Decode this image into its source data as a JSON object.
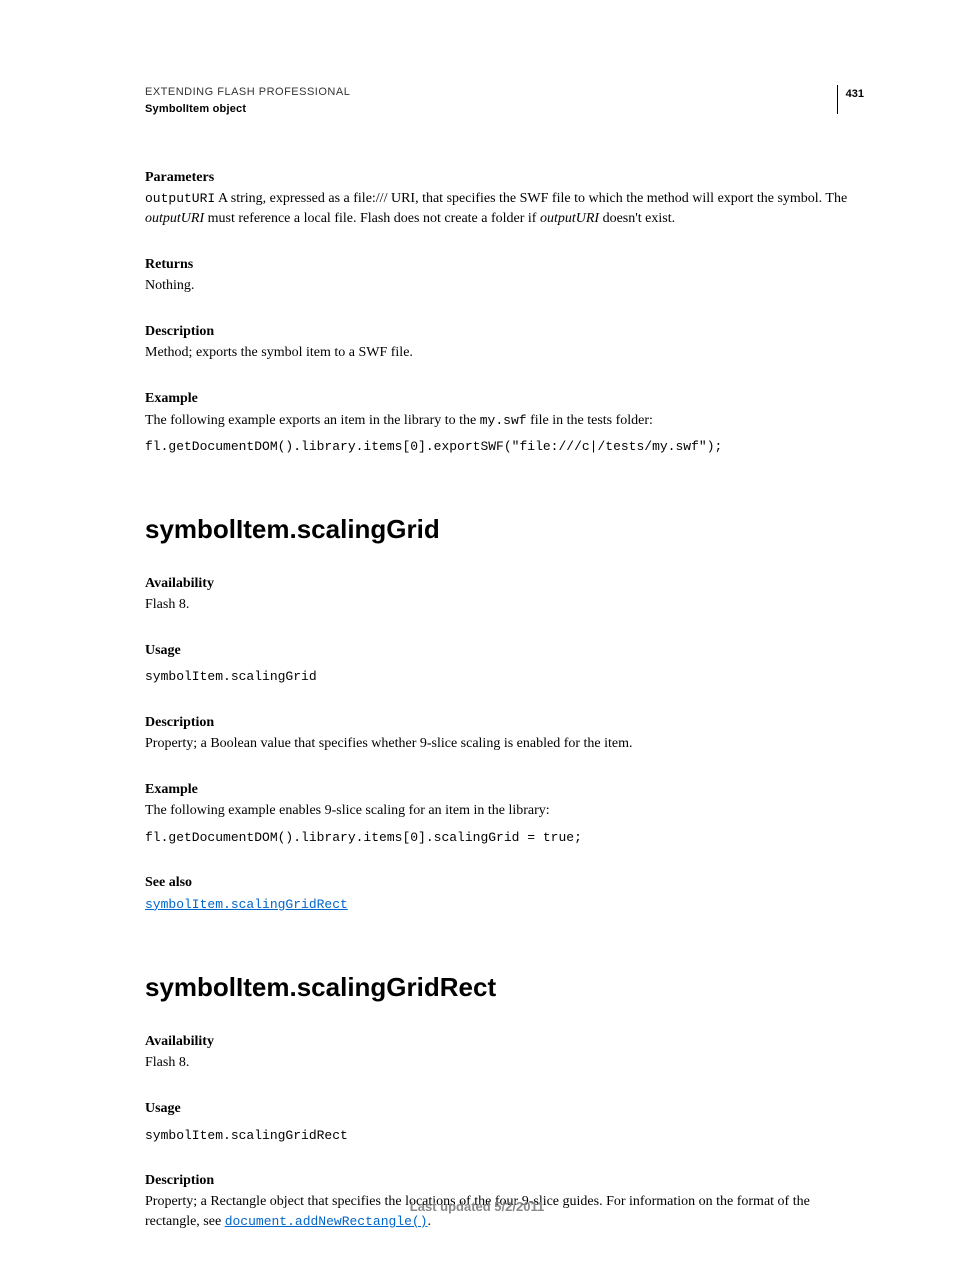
{
  "header": {
    "title": "EXTENDING FLASH PROFESSIONAL",
    "subtitle": "SymbolItem object",
    "pageNumber": "431"
  },
  "s1": {
    "parametersLabel": "Parameters",
    "paramName": "outputURI",
    "paramText1": "  A string, expressed as a file:/// URI, that specifies the SWF file to which the method will export the symbol. The ",
    "paramItalic1": "outputURI",
    "paramText2": " must reference a local file. Flash does not create a folder if ",
    "paramItalic2": "outputURI",
    "paramText3": " doesn't exist.",
    "returnsLabel": "Returns",
    "returnsText": "Nothing.",
    "descriptionLabel": "Description",
    "descriptionText": "Method; exports the symbol item to a SWF file.",
    "exampleLabel": "Example",
    "exampleText1": "The following example exports an item in the library to the ",
    "exampleCode1": "my.swf",
    "exampleText2": " file in the tests folder:",
    "codeBlock": "fl.getDocumentDOM().library.items[0].exportSWF(\"file:///c|/tests/my.swf\");"
  },
  "s2": {
    "heading": "symbolItem.scalingGrid",
    "availabilityLabel": "Availability",
    "availabilityText": "Flash 8.",
    "usageLabel": "Usage",
    "usageCode": "symbolItem.scalingGrid",
    "descriptionLabel": "Description",
    "descriptionText": "Property; a Boolean value that specifies whether 9-slice scaling is enabled for the item.",
    "exampleLabel": "Example",
    "exampleText": "The following example enables 9-slice scaling for an item in the library:",
    "codeBlock": "fl.getDocumentDOM().library.items[0].scalingGrid = true;",
    "seeAlsoLabel": "See also",
    "seeAlsoLink": "symbolItem.scalingGridRect"
  },
  "s3": {
    "heading": "symbolItem.scalingGridRect",
    "availabilityLabel": "Availability",
    "availabilityText": "Flash 8.",
    "usageLabel": "Usage",
    "usageCode": "symbolItem.scalingGridRect",
    "descriptionLabel": "Description",
    "descriptionText1": "Property; a Rectangle object that specifies the locations of the four 9-slice guides. For information on the format of the rectangle, see ",
    "descriptionLink": "document.addNewRectangle()",
    "descriptionText2": "."
  },
  "footer": {
    "text": "Last updated 5/2/2011"
  }
}
